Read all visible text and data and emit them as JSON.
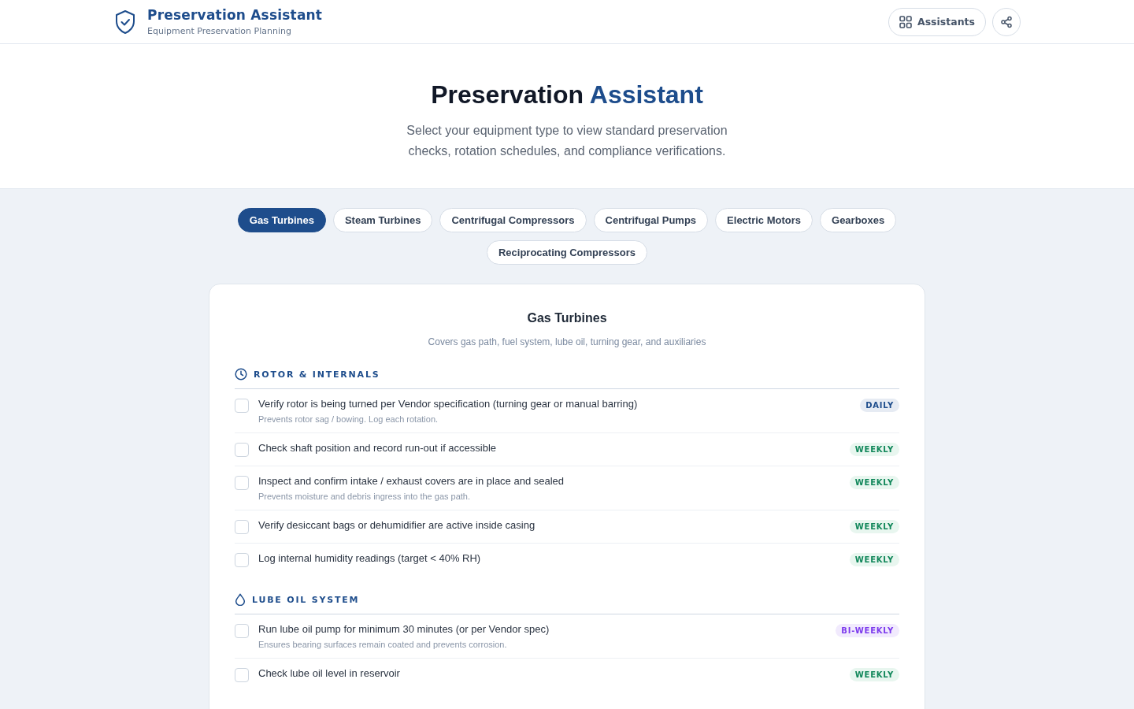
{
  "header": {
    "title": "Preservation Assistant",
    "subtitle": "Equipment Preservation Planning",
    "buttons": [
      {
        "kind": "grid",
        "label": "Assistants"
      },
      {
        "kind": "share"
      }
    ]
  },
  "hero": {
    "title": "Preservation",
    "title_accent": "Assistant",
    "description": "Select your equipment type to view standard preservation checks, rotation schedules, and compliance verifications."
  },
  "tabs": [
    {
      "label": "Gas Turbines",
      "selected": true
    },
    {
      "label": "Steam Turbines",
      "selected": false
    },
    {
      "label": "Centrifugal Compressors",
      "selected": false
    },
    {
      "label": "Centrifugal Pumps",
      "selected": false
    },
    {
      "label": "Electric Motors",
      "selected": false
    },
    {
      "label": "Gearboxes",
      "selected": false
    },
    {
      "label": "Reciprocating Compressors",
      "selected": false
    }
  ],
  "card": {
    "title": "Gas Turbines",
    "subtitle": "Covers gas path, fuel system, lube oil, turning gear, and auxiliaries",
    "sections": [
      {
        "kind": "clock",
        "title": "ROTOR & INTERNALS",
        "items": [
          {
            "text": "Verify rotor is being turned per Vendor specification (turning gear or manual barring)",
            "note": "Prevents rotor sag / bowing. Log each rotation.",
            "frequency": "DAILY",
            "kind": "daily",
            "checked": false
          },
          {
            "text": "Check shaft position and record run-out if accessible",
            "frequency": "WEEKLY",
            "kind": "weekly",
            "checked": false
          },
          {
            "text": "Inspect and confirm intake / exhaust covers are in place and sealed",
            "note": "Prevents moisture and debris ingress into the gas path.",
            "frequency": "WEEKLY",
            "kind": "weekly",
            "checked": false
          },
          {
            "text": "Verify desiccant bags or dehumidifier are active inside casing",
            "frequency": "WEEKLY",
            "kind": "weekly",
            "checked": false
          },
          {
            "text": "Log internal humidity readings (target < 40% RH)",
            "frequency": "WEEKLY",
            "kind": "weekly",
            "checked": false
          }
        ]
      },
      {
        "kind": "drop",
        "title": "LUBE OIL SYSTEM",
        "items": [
          {
            "text": "Run lube oil pump for minimum 30 minutes (or per Vendor spec)",
            "note": "Ensures bearing surfaces remain coated and prevents corrosion.",
            "frequency": "BI-WEEKLY",
            "kind": "biweekly",
            "checked": false
          },
          {
            "text": "Check lube oil level in reservoir",
            "frequency": "WEEKLY",
            "kind": "weekly",
            "checked": false
          }
        ]
      }
    ]
  }
}
